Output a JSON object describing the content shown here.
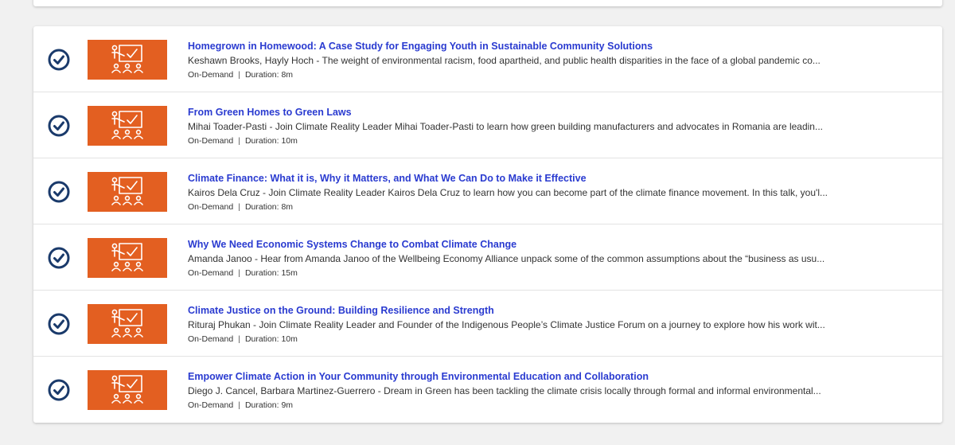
{
  "colors": {
    "accent_link": "#2a3bd0",
    "thumb_bg": "#e35f21",
    "check": "#1a3a6b"
  },
  "icons": {
    "status": "check-circle-icon",
    "thumbnail": "presentation-audience-icon"
  },
  "sessions": [
    {
      "title": "Homegrown in Homewood: A Case Study for Engaging Youth in Sustainable Community Solutions",
      "description": "Keshawn Brooks, Hayly Hoch - The weight of environmental racism, food apartheid, and public health disparities in the face of a global pandemic co...",
      "format": "On-Demand",
      "separator": "|",
      "duration": "Duration: 8m"
    },
    {
      "title": "From Green Homes to Green Laws",
      "description": "Mihai Toader-Pasti - Join Climate Reality Leader Mihai Toader-Pasti to learn how green building manufacturers and advocates in Romania are leadin...",
      "format": "On-Demand",
      "separator": "|",
      "duration": "Duration: 10m"
    },
    {
      "title": "Climate Finance: What it is, Why it Matters, and What We Can Do to Make it Effective",
      "description": "Kairos Dela Cruz - Join Climate Reality Leader Kairos Dela Cruz to learn how you can become part of the climate finance movement. In this talk, you'l...",
      "format": "On-Demand",
      "separator": "|",
      "duration": "Duration: 8m"
    },
    {
      "title": "Why We Need Economic Systems Change to Combat Climate Change",
      "description": "Amanda Janoo - Hear from Amanda Janoo of the Wellbeing Economy Alliance unpack some of the common assumptions about the “business as usu...",
      "format": "On-Demand",
      "separator": "|",
      "duration": "Duration: 15m"
    },
    {
      "title": "Climate Justice on the Ground: Building Resilience and Strength",
      "description": "Rituraj Phukan - Join Climate Reality Leader and Founder of the Indigenous People’s Climate Justice Forum on a journey to explore how his work wit...",
      "format": "On-Demand",
      "separator": "|",
      "duration": "Duration: 10m"
    },
    {
      "title": "Empower Climate Action in Your Community through Environmental Education and Collaboration",
      "description": "Diego J. Cancel, Barbara Martinez-Guerrero - Dream in Green has been tackling the climate crisis locally through formal and informal environmental...",
      "format": "On-Demand",
      "separator": "|",
      "duration": "Duration: 9m"
    }
  ]
}
